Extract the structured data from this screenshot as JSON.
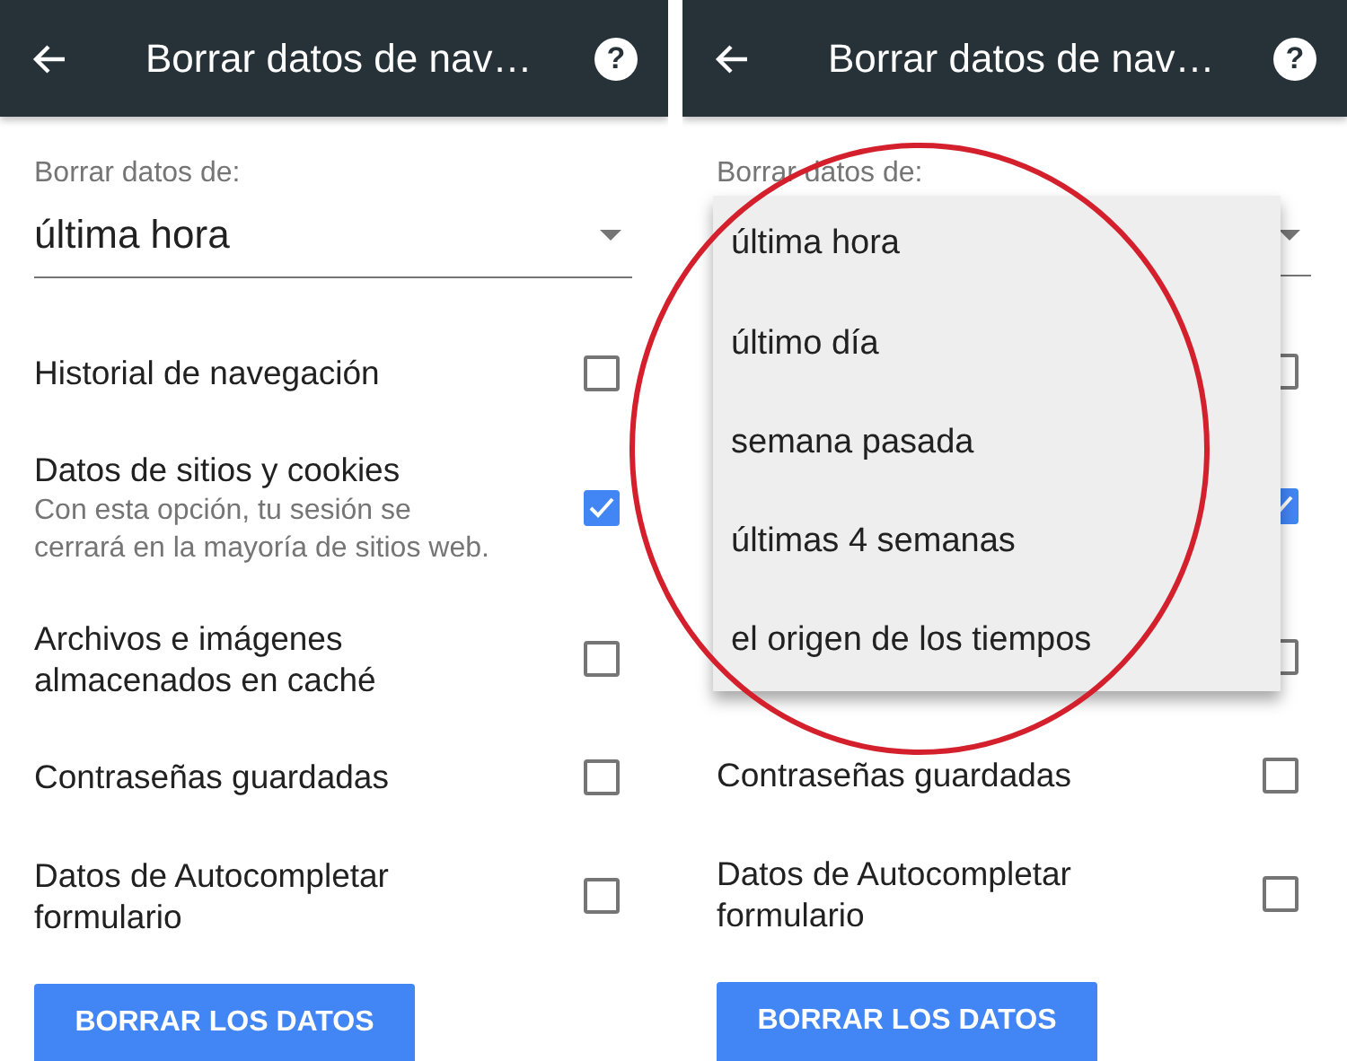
{
  "screens": [
    {
      "title": "Borrar datos de nav…",
      "help_button": "?",
      "field_label": "Borrar datos de:",
      "select_value": "última hora",
      "items": [
        {
          "label": "Historial de navegación",
          "checked": false
        },
        {
          "label": "Datos de sitios y cookies",
          "description": "Con esta opción, tu sesión se cerrará en la mayoría de sitios web.",
          "checked": true
        },
        {
          "label": "Archivos e imágenes almacenados en caché",
          "checked": false
        },
        {
          "label": "Contraseñas guardadas",
          "checked": false
        },
        {
          "label": "Datos de Autocompletar formulario",
          "checked": false
        }
      ],
      "button": "BORRAR LOS DATOS"
    },
    {
      "title": "Borrar datos de nav…",
      "help_button": "?",
      "field_label": "Borrar datos de:",
      "items": [
        {
          "checked": false
        },
        {
          "checked": true
        },
        {
          "checked": false
        },
        {
          "label": "Contraseñas guardadas",
          "checked": false
        },
        {
          "label": "Datos de Autocompletar formulario",
          "checked": false
        }
      ],
      "button": "BORRAR LOS DATOS",
      "menu": [
        "última hora",
        "último día",
        "semana pasada",
        "últimas 4 semanas",
        "el origen de los tiempos"
      ]
    }
  ]
}
